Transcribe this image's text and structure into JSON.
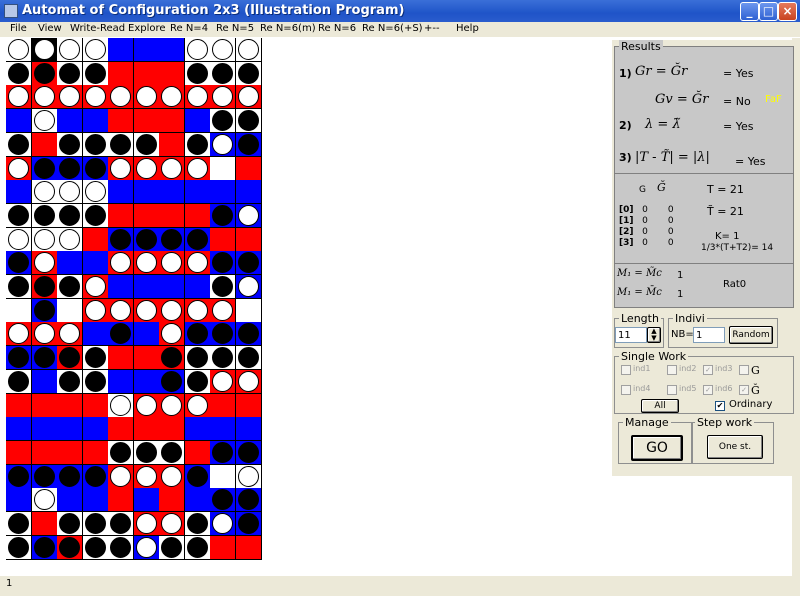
{
  "window": {
    "title": "Automat of Configuration 2x3 (Illustration Program)"
  },
  "menu": [
    "File",
    "View",
    "Write-Read",
    "Explore",
    "Re N=4",
    "Re N=5",
    "Re N=6(m)",
    "Re N=6",
    "Re N=6(+S)",
    "+--",
    "Help"
  ],
  "board": {
    "legend": {
      "R": "#ff0000",
      "B": "#0000ff",
      "W": "#ffffff",
      "k": "#000000",
      "w": "#ffffff"
    },
    "rows": [
      "ww,kw,ww,ww,BB,BB,BB,ww,ww,ww,WW,WW,WW,WW,WW,WW,WW,WW,WW,WW,WW,WW,WW,WW,WW,WW",
      "Wk,Rk,Wk,Wk,RR,RR,RR,Wk,Wk,Wk",
      "Rw,Rw,Rw,Rw,Rw,Rw,Rw,Rw,Rw,Rw",
      "BB,Ww,BB,BB,RR,RR,RR,BB,Wk,Wk",
      "Wk,RR,Wk,Wk,Wk,Wk,RR,Wk,Bw,Bk",
      "Rw,Bk,Bk,Bk,Rw,Rw,Rw,Rw,WW,RR",
      "BB,Ww,Ww,Ww,BB,BB,BB,BB,BB,BB",
      "Wk,Wk,Wk,Wk,RR,RR,RR,RR,Bk,Bw",
      "Ww,Ww,Ww,RR,Bk,Bk,Bk,Bk,RR,RR",
      "Bk,Rw,BB,BB,Rw,Rw,Rw,Rw,Bk,Bk",
      "Wk,Rk,Wk,Rw,BB,BB,BB,BB,Wk,Bw",
      "WW,Bk,WW,Rw,Rw,Rw,Rw,Rw,Rw,WW",
      "Rw,Rw,Rw,BB,Bk,BB,Rw,Bk,Bk,Bk",
      "Bk,Bk,Rk,Wk,RR,RR,Rk,Wk,Wk,Wk",
      "Wk,BB,Wk,Wk,BB,BB,Bk,Wk,Rw,Rw",
      "RR,RR,RR,RR,Ww,Rw,Rw,Rw,RR,RR",
      "BB,BB,BB,BB,RR,RR,RR,BB,BB,BB",
      "RR,RR,RR,RR,Wk,Wk,Wk,RR,Bk,Bk",
      "Bk,Bk,Bk,Bk,Rw,Rw,Rw,Bk,WW,Ww",
      "BB,Ww,BB,BB,RR,BB,RR,BB,Bk,Bk",
      "Wk,RR,Wk,Wk,Wk,Rw,Rw,Wk,Bw,Bk",
      "Wk,Bk,Rk,Wk,Wk,Bw,Wk,Wk,RR,RR"
    ]
  },
  "results": {
    "label": "Results",
    "row1_num": "1)",
    "row1_expr": "Gr = Ğr",
    "row1_val": "= Yes",
    "row1b_expr": "Gv = Ğr",
    "row1b_val": "= No",
    "row1b_tag": "FaF",
    "row2_num": "2)",
    "row2_expr": "λ = λ̃",
    "row2_val": "= Yes",
    "row3_num": "3)",
    "row3_expr": "|T - T̃| = |λ|",
    "row3_val": "= Yes",
    "g_label": "G",
    "gt_label": "Ğ",
    "table_rows": [
      {
        "k": "[0]",
        "a": "0",
        "b": "0"
      },
      {
        "k": "[1]",
        "a": "0",
        "b": "0"
      },
      {
        "k": "[2]",
        "a": "0",
        "b": "0"
      },
      {
        "k": "[3]",
        "a": "0",
        "b": "0"
      }
    ],
    "T_line": "T = 21",
    "Tt_line": "T̃ = 21",
    "K_line": "K= 1",
    "formula": "1/3*(T+T2)= 14",
    "m1": "M₁ = M̃c",
    "m1_val": "1",
    "m2": "M₁ = M̄c",
    "m2_val": "1",
    "ratio": "Rat0"
  },
  "length": {
    "label": "Length",
    "value": "11"
  },
  "indivi": {
    "label": "Indivi",
    "nb_label": "NB=",
    "nb_value": "1",
    "random_label": "Random"
  },
  "single_work": {
    "label": "Single Work",
    "items": [
      {
        "label": "ind1",
        "checked": false
      },
      {
        "label": "ind2",
        "checked": false
      },
      {
        "label": "ind3",
        "checked": true
      },
      {
        "label": "G",
        "checked": false
      },
      {
        "label": "ind4",
        "checked": false
      },
      {
        "label": "ind5",
        "checked": false
      },
      {
        "label": "ind6",
        "checked": true
      },
      {
        "label": "Ğ",
        "checked": true
      }
    ],
    "all_label": "All",
    "ordinary_label": "Ordinary",
    "ordinary_checked": true
  },
  "manage": {
    "label": "Manage",
    "go_label": "GO"
  },
  "step_work": {
    "label": "Step work",
    "one_label": "One st."
  },
  "status": {
    "text": "1"
  }
}
